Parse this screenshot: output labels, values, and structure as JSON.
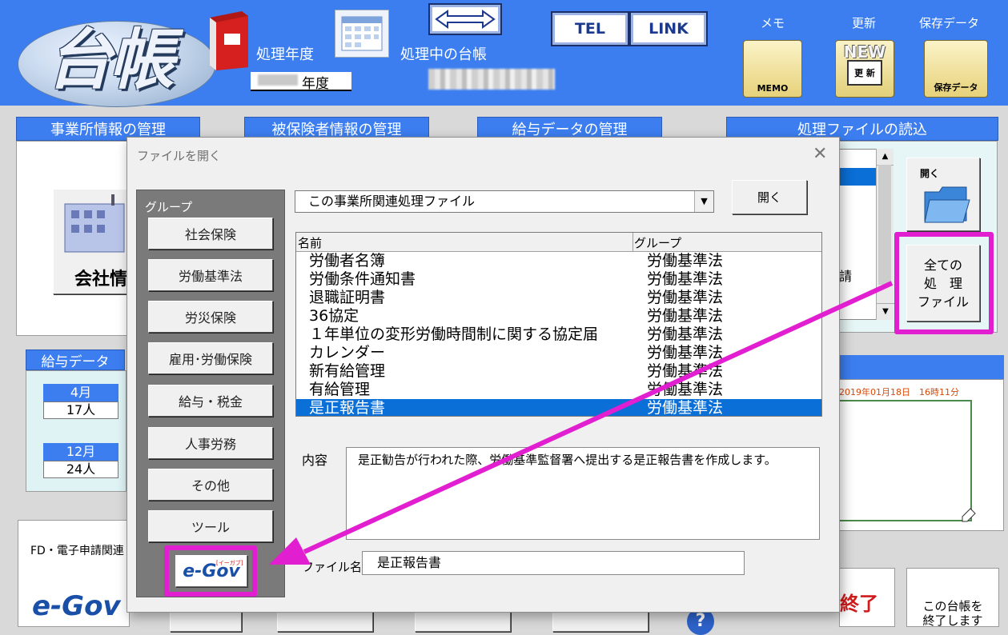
{
  "header": {
    "logo_text": "台帳",
    "processing_year_label": "処理年度",
    "current_ledger_label": "処理中の台帳",
    "year_suffix": "年度",
    "tel_label": "TEL",
    "link_label": "LINK",
    "memo_label": "メモ",
    "update_label": "更新",
    "saved_data_label": "保存データ",
    "memo_icon_text": "MEMO",
    "new_icon_text": "NEW",
    "update_icon_text": "更 新",
    "saved_icon_text": "保存データ"
  },
  "background": {
    "office_tab": "事業所情報の管理",
    "insured_tab": "被保険者情報の管理",
    "payroll_tab": "給与データの管理",
    "file_read_tab": "処理ファイルの読込",
    "company_info_label": "会社情",
    "salary_data_label": "給与データ",
    "month1": "4月",
    "count1": "17人",
    "month2": "12月",
    "count2": "24人",
    "fd_label": "FD・電子申請関連",
    "egov_text": "e-Gov",
    "open_label": "開く",
    "all_files_line1": "全ての",
    "all_files_line2": "処　理",
    "all_files_line3": "ファイル",
    "partial_text": "請",
    "timestamp": "2019年01月18日　16時11分",
    "end_label": "終了",
    "close_note_line1": "この台帳を",
    "close_note_line2": "終了します"
  },
  "dialog": {
    "title": "ファイルを開く",
    "group_label": "グループ",
    "groups": [
      "社会保険",
      "労働基準法",
      "労災保険",
      "雇用･労働保険",
      "給与・税金",
      "人事労務",
      "その他",
      "ツール"
    ],
    "egov_button": "e-Gov",
    "egov_small": "[イーガブ]",
    "combo_value": "この事業所関連処理ファイル",
    "open_button": "開く",
    "list_headers": {
      "name": "名前",
      "group": "グループ"
    },
    "rows": [
      {
        "name": "労働者名簿",
        "group": "労働基準法"
      },
      {
        "name": "労働条件通知書",
        "group": "労働基準法"
      },
      {
        "name": "退職証明書",
        "group": "労働基準法"
      },
      {
        "name": "36協定",
        "group": "労働基準法"
      },
      {
        "name": "１年単位の変形労働時間制に関する協定届",
        "group": "労働基準法"
      },
      {
        "name": "カレンダー",
        "group": "労働基準法"
      },
      {
        "name": "新有給管理",
        "group": "労働基準法"
      },
      {
        "name": "有給管理",
        "group": "労働基準法"
      },
      {
        "name": "是正報告書",
        "group": "労働基準法"
      }
    ],
    "content_label": "内容",
    "description": "是正勧告が行われた際、労働基準監督署へ提出する是正報告書を作成します。",
    "filename_label": "ファイル名",
    "filename_value": "是正報告書"
  },
  "colors": {
    "header_blue": "#3c7ef0",
    "selection": "#0a6fd7",
    "annotation": "#e21fd0"
  }
}
